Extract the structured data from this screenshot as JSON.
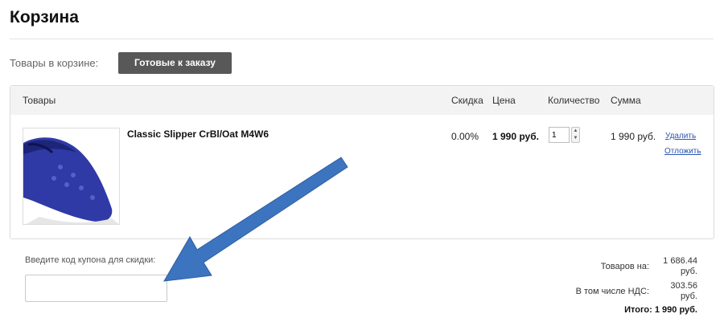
{
  "page": {
    "title": "Корзина"
  },
  "cart_tabs": {
    "label": "Товары в корзине:",
    "ready_label": "Готовые к заказу"
  },
  "table": {
    "headers": {
      "goods": "Товары",
      "discount": "Скидка",
      "price": "Цена",
      "quantity": "Количество",
      "sum": "Сумма"
    },
    "item": {
      "name": "Classic Slipper CrBl/Oat M4W6",
      "discount": "0.00%",
      "price": "1 990 руб.",
      "quantity": "1",
      "sum": "1 990 руб.",
      "delete_label": "Удалить",
      "postpone_label": "Отложить",
      "image_icon": "blue-slipper-image"
    }
  },
  "coupon": {
    "label": "Введите код купона для скидки:",
    "value": "",
    "placeholder": ""
  },
  "totals": {
    "goods_label": "Товаров на:",
    "goods_value_line1": "1 686.44",
    "goods_value_line2": "руб.",
    "vat_label": "В том числе НДС:",
    "vat_value_line1": "303.56",
    "vat_value_line2": "руб.",
    "grand_total": "Итого: 1 990 руб."
  },
  "colors": {
    "ready_button": "#585858",
    "link": "#2a55b0",
    "arrow": "#3c74c0",
    "product": "#2f3aa6"
  }
}
